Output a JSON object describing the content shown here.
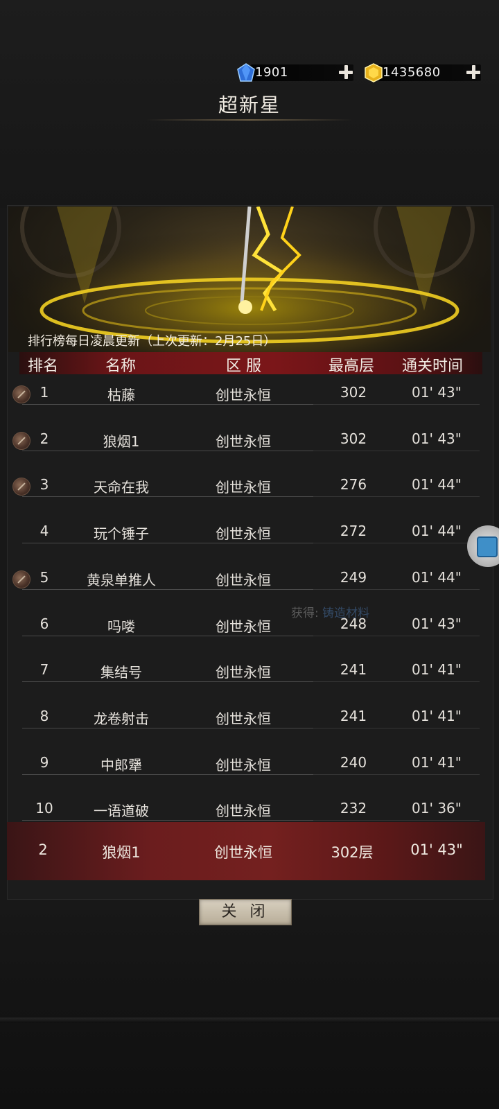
{
  "currency": {
    "diamond": {
      "value": "1901",
      "icon": "blue-diamond-icon",
      "color": "#2f6fd8"
    },
    "gold": {
      "value": "1435680",
      "icon": "gold-gem-icon",
      "color": "#e8b21c"
    }
  },
  "title": "超新星",
  "notice": "排行榜每日凌晨更新（上次更新：2月25日）",
  "table": {
    "headers": [
      "排名",
      "名称",
      "区 服",
      "最高层",
      "通关时间"
    ],
    "rows": [
      {
        "rank": "1",
        "name": "枯藤",
        "server": "创世永恒",
        "floor": "302",
        "time": "01' 43\"",
        "medal": true
      },
      {
        "rank": "2",
        "name": "狼烟1",
        "server": "创世永恒",
        "floor": "302",
        "time": "01' 43\"",
        "medal": true
      },
      {
        "rank": "3",
        "name": "天命在我",
        "server": "创世永恒",
        "floor": "276",
        "time": "01' 44\"",
        "medal": true
      },
      {
        "rank": "4",
        "name": "玩个锤子",
        "server": "创世永恒",
        "floor": "272",
        "time": "01' 44\"",
        "medal": false
      },
      {
        "rank": "5",
        "name": "黄泉单推人",
        "server": "创世永恒",
        "floor": "249",
        "time": "01' 44\"",
        "medal": true
      },
      {
        "rank": "6",
        "name": "吗喽",
        "server": "创世永恒",
        "floor": "248",
        "time": "01' 43\"",
        "medal": false
      },
      {
        "rank": "7",
        "name": "集结号",
        "server": "创世永恒",
        "floor": "241",
        "time": "01' 41\"",
        "medal": false
      },
      {
        "rank": "8",
        "name": "龙卷射击",
        "server": "创世永恒",
        "floor": "241",
        "time": "01' 41\"",
        "medal": false
      },
      {
        "rank": "9",
        "name": "中郎犟",
        "server": "创世永恒",
        "floor": "240",
        "time": "01' 41\"",
        "medal": false
      },
      {
        "rank": "10",
        "name": "一语道破",
        "server": "创世永恒",
        "floor": "232",
        "time": "01' 36\"",
        "medal": false
      }
    ]
  },
  "my_rank": {
    "rank": "2",
    "name": "狼烟1",
    "server": "创世永恒",
    "floor": "302层",
    "time": "01' 43\""
  },
  "ghost_text": {
    "label": "获得:",
    "item": "铸造材料"
  },
  "close_label": "关 闭",
  "colors": {
    "header_red": "#7b1619",
    "my_row_red": "#6b1d1e",
    "banner_gold": "#f5d000"
  }
}
